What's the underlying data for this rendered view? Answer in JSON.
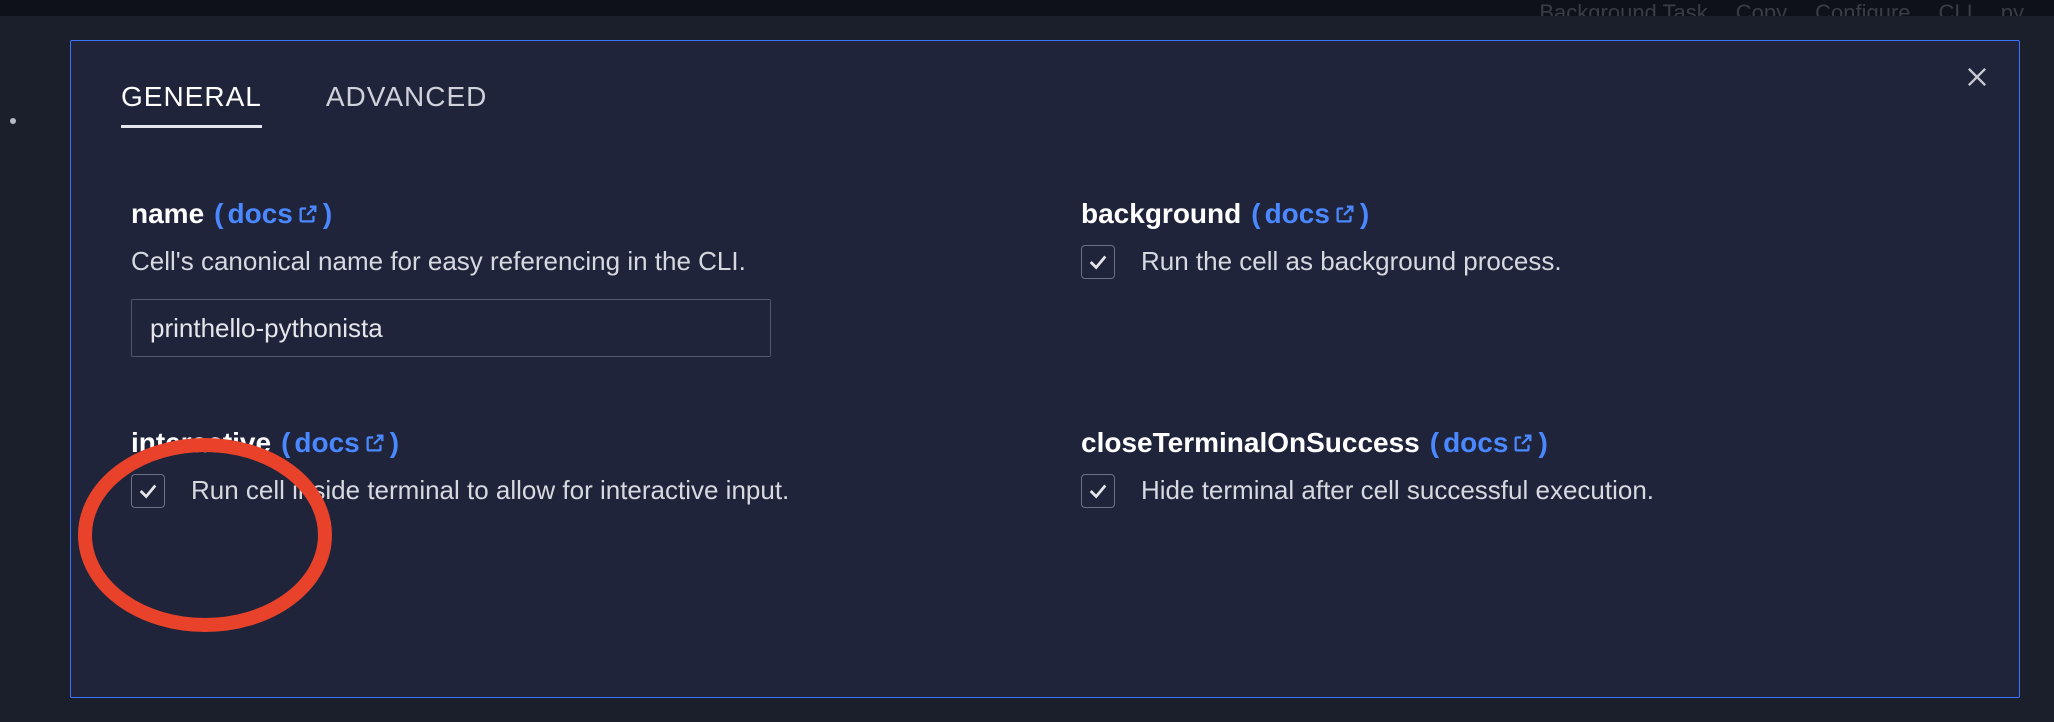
{
  "toolbar": {
    "background_task": "Background Task",
    "copy": "Copy",
    "configure": "Configure",
    "cli": "CLI",
    "lang": "py"
  },
  "tabs": {
    "general": "GENERAL",
    "advanced": "ADVANCED"
  },
  "docs_link_text": "docs",
  "fields": {
    "name": {
      "title": "name",
      "desc": "Cell's canonical name for easy referencing in the CLI.",
      "value": "printhello-pythonista"
    },
    "background": {
      "title": "background",
      "label": "Run the cell as background process."
    },
    "interactive": {
      "title": "interactive",
      "label": "Run cell inside terminal to allow for interactive input."
    },
    "closeTerminalOnSuccess": {
      "title": "closeTerminalOnSuccess",
      "label": "Hide terminal after cell successful execution."
    }
  }
}
